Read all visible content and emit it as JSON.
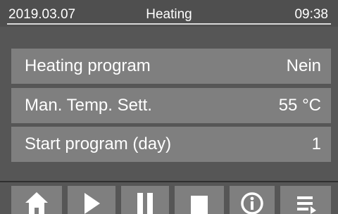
{
  "status_bar": {
    "date": "2019.03.07",
    "title": "Heating",
    "time": "09:38"
  },
  "params": [
    {
      "label": "Heating program",
      "value": "Nein"
    },
    {
      "label": "Man. Temp. Sett.",
      "value": "55 °C"
    },
    {
      "label": "Start program (day)",
      "value": "1"
    }
  ],
  "toolbar": {
    "buttons": [
      {
        "icon": "home-icon"
      },
      {
        "icon": "play-icon"
      },
      {
        "icon": "pause-icon"
      },
      {
        "icon": "stop-icon"
      },
      {
        "icon": "info-icon"
      },
      {
        "icon": "menu-icon"
      }
    ]
  },
  "colors": {
    "background": "#565656",
    "row_background": "#7f7f7f",
    "text": "#ffffff"
  }
}
